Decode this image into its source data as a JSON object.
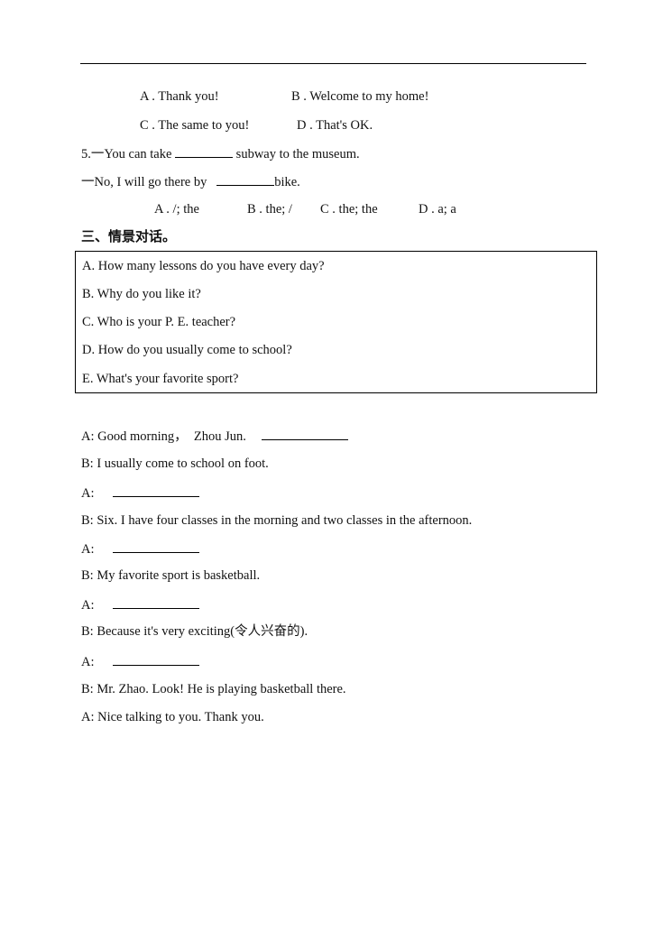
{
  "q4_options": {
    "a": "A . Thank you!",
    "b": "B . Welcome to my home!",
    "c": "C . The same to you!",
    "d": "D . That's OK."
  },
  "q5": {
    "line1_pre": "5.一You can take ",
    "line1_post": " subway to the museum.",
    "line2_pre": "一No, I will go there by   ",
    "line2_post": "bike.",
    "options": {
      "a": "A . /; the",
      "b": "B . the; /",
      "c": "C . the; the",
      "d": "D . a; a"
    }
  },
  "section_title": "三、情景对话。",
  "choices": [
    "A. How many lessons do you have every day?",
    "B. Why do you like it?",
    "C. Who is your P. E. teacher?",
    "D. How do you usually come to school?",
    "E. What's your favorite sport?"
  ],
  "dialogue": [
    {
      "text": "A: Good morning，  Zhou Jun.   ",
      "blank": true
    },
    {
      "text": "B: I usually come to school on foot.",
      "blank": false
    },
    {
      "text": "A:   ",
      "blank": true
    },
    {
      "text": "B: Six. I have four classes in the morning and two classes in the afternoon.",
      "blank": false
    },
    {
      "text": "A:   ",
      "blank": true
    },
    {
      "text": "B: My favorite sport is basketball.",
      "blank": false
    },
    {
      "text": "A:   ",
      "blank": true
    },
    {
      "text": "B: Because it's very exciting(令人兴奋的).",
      "blank": false
    },
    {
      "text": "A:   ",
      "blank": true
    },
    {
      "text": "B: Mr. Zhao. Look! He is playing basketball there.",
      "blank": false
    },
    {
      "text": "A: Nice talking to you. Thank you.",
      "blank": false
    }
  ]
}
